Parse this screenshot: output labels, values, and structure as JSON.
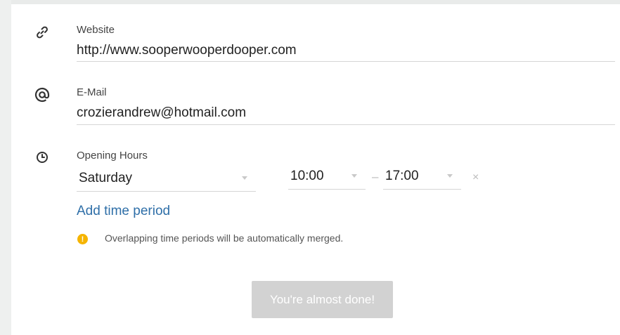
{
  "website": {
    "icon": "link-icon",
    "label": "Website",
    "value": "http://www.sooperwooperdooper.com"
  },
  "email": {
    "icon": "at-icon",
    "label": "E-Mail",
    "value": "crozierandrew@hotmail.com"
  },
  "opening_hours": {
    "icon": "clock-icon",
    "label": "Opening Hours",
    "day": "Saturday",
    "from": "10:00",
    "separator": "–",
    "to": "17:00",
    "remove_symbol": "×",
    "add_period_label": "Add time period",
    "notice_symbol": "!",
    "notice": "Overlapping time periods will be automatically merged."
  },
  "submit_label": "You're almost done!",
  "colors": {
    "link": "#2f6fa8",
    "warning": "#f5b400",
    "button_disabled": "#d2d2d2"
  }
}
